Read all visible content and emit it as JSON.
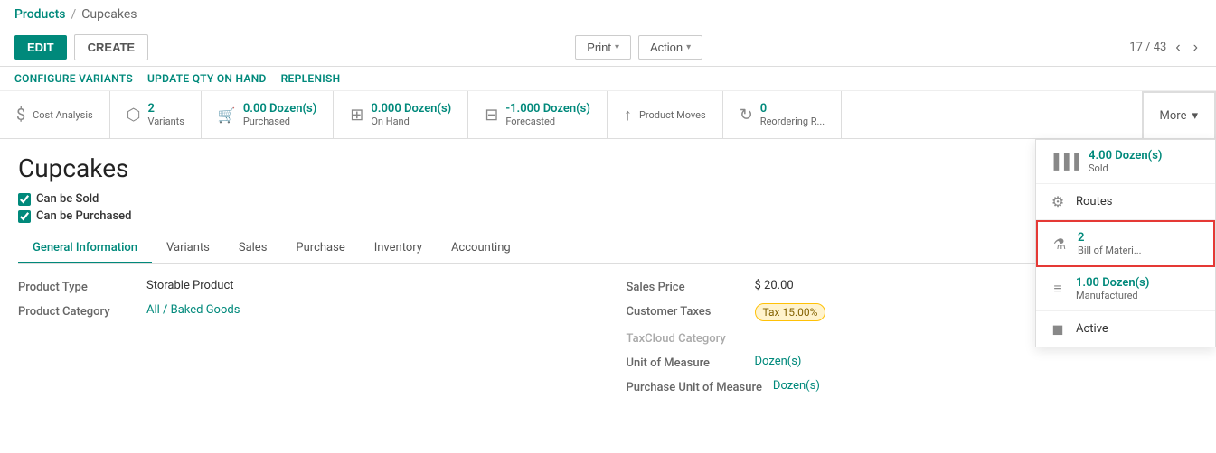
{
  "breadcrumb": {
    "parent_label": "Products",
    "separator": "/",
    "current_label": "Cupcakes"
  },
  "header": {
    "edit_label": "EDIT",
    "create_label": "CREATE",
    "print_label": "Print",
    "action_label": "Action",
    "pagination": {
      "current": "17",
      "total": "43",
      "display": "17 / 43"
    }
  },
  "action_bar": {
    "configure_variants": "CONFIGURE VARIANTS",
    "update_qty": "UPDATE QTY ON HAND",
    "replenish": "REPLENISH"
  },
  "smart_buttons": [
    {
      "id": "cost-analysis",
      "icon": "dollar",
      "value": "",
      "label": "Cost Analysis"
    },
    {
      "id": "variants",
      "icon": "users",
      "value": "2",
      "label": "Variants"
    },
    {
      "id": "purchased",
      "icon": "cart",
      "value": "0.00 Dozen(s)",
      "label": "Purchased"
    },
    {
      "id": "on-hand",
      "icon": "grid",
      "value": "0.000 Dozen(s)",
      "label": "On Hand"
    },
    {
      "id": "forecasted",
      "icon": "grid2",
      "value": "-1.000 Dozen(s)",
      "label": "Forecasted"
    },
    {
      "id": "product-moves",
      "icon": "arrow",
      "value": "",
      "label": "Product Moves"
    },
    {
      "id": "reordering",
      "icon": "refresh",
      "value": "0",
      "label": "Reordering R..."
    }
  ],
  "more_button": {
    "label": "More",
    "chevron": "▾"
  },
  "more_items": [
    {
      "id": "sold",
      "icon": "bar",
      "value": "4.00 Dozen(s)",
      "label": "Sold",
      "highlighted": false
    },
    {
      "id": "routes",
      "icon": "gear",
      "value": "",
      "label": "Routes",
      "highlighted": false
    },
    {
      "id": "bom",
      "icon": "flask",
      "value": "2",
      "label": "Bill of Materi...",
      "highlighted": true
    },
    {
      "id": "manufactured",
      "icon": "list",
      "value": "1.00 Dozen(s)",
      "label": "Manufactured",
      "highlighted": false
    },
    {
      "id": "active",
      "icon": "cube",
      "value": "",
      "label": "Active",
      "highlighted": false
    }
  ],
  "product": {
    "name": "Cupcakes",
    "can_be_sold_label": "Can be Sold",
    "can_be_purchased_label": "Can be Purchased",
    "can_be_sold_checked": true,
    "can_be_purchased_checked": true
  },
  "tabs": [
    {
      "id": "general",
      "label": "General Information",
      "active": true
    },
    {
      "id": "variants",
      "label": "Variants",
      "active": false
    },
    {
      "id": "sales",
      "label": "Sales",
      "active": false
    },
    {
      "id": "purchase",
      "label": "Purchase",
      "active": false
    },
    {
      "id": "inventory",
      "label": "Inventory",
      "active": false
    },
    {
      "id": "accounting",
      "label": "Accounting",
      "active": false
    }
  ],
  "general_info": {
    "left": [
      {
        "label": "Product Type",
        "value": "Storable Product",
        "type": "text"
      },
      {
        "label": "Product Category",
        "value": "All / Baked Goods",
        "type": "link"
      }
    ],
    "right": [
      {
        "label": "Sales Price",
        "value": "$ 20.00",
        "type": "text"
      },
      {
        "label": "Customer Taxes",
        "value": "Tax 15.00%",
        "type": "badge"
      },
      {
        "label": "TaxCloud Category",
        "value": "",
        "type": "muted"
      },
      {
        "label": "Unit of Measure",
        "value": "Dozen(s)",
        "type": "link"
      },
      {
        "label": "Purchase Unit of\nMeasure",
        "value": "Dozen(s)",
        "type": "link"
      }
    ]
  }
}
